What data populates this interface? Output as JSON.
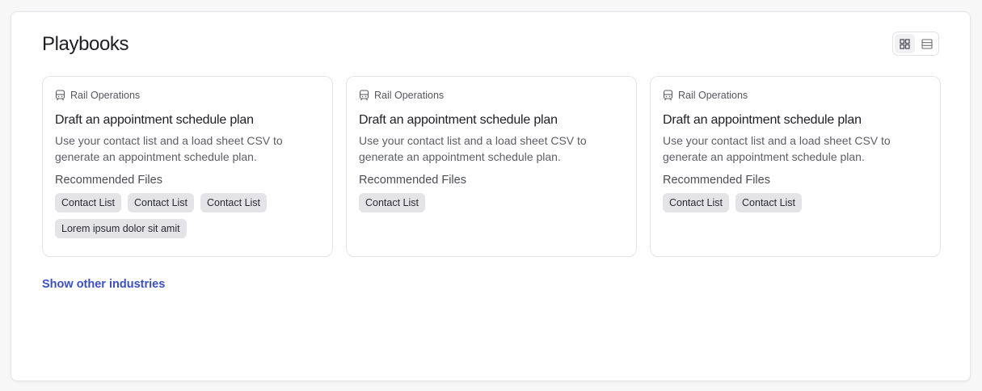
{
  "header": {
    "title": "Playbooks"
  },
  "view_toggle": {
    "options": [
      {
        "icon": "grid-view-icon",
        "active": true
      },
      {
        "icon": "list-view-icon",
        "active": false
      }
    ]
  },
  "cards": [
    {
      "industry": "Rail Operations",
      "industry_icon": "train-icon",
      "title": "Draft an appointment schedule plan",
      "description": "Use your contact list and a load sheet CSV to generate an appointment schedule plan.",
      "recommended_label": "Recommended Files",
      "files": [
        "Contact List",
        "Contact List",
        "Contact List",
        "Lorem ipsum dolor sit amit"
      ]
    },
    {
      "industry": "Rail Operations",
      "industry_icon": "train-icon",
      "title": "Draft an appointment schedule plan",
      "description": "Use your contact list and a load sheet CSV to generate an appointment schedule plan.",
      "recommended_label": "Recommended Files",
      "files": [
        "Contact List"
      ]
    },
    {
      "industry": "Rail Operations",
      "industry_icon": "train-icon",
      "title": "Draft an appointment schedule plan",
      "description": "Use your contact list and a load sheet CSV to generate an appointment schedule plan.",
      "recommended_label": "Recommended Files",
      "files": [
        "Contact List",
        "Contact List"
      ]
    }
  ],
  "footer": {
    "show_more_label": "Show other industries"
  },
  "colors": {
    "accent": "#3a4fd0",
    "chip_bg": "#e4e4e6"
  }
}
